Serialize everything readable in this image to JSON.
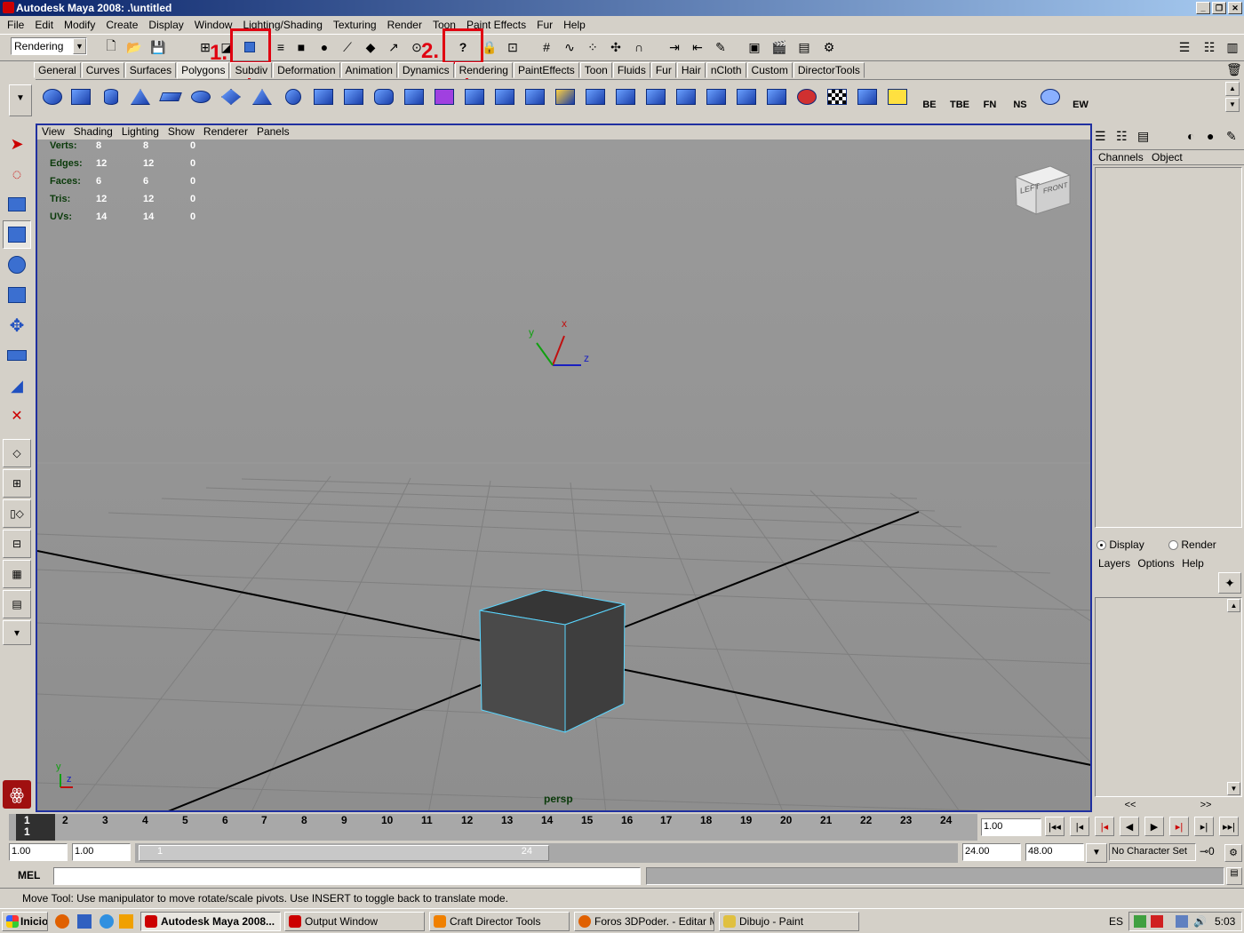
{
  "window": {
    "title": "Autodesk Maya 2008: .\\untitled",
    "min": "_",
    "max": "❐",
    "close": "✕"
  },
  "menu": [
    "File",
    "Edit",
    "Modify",
    "Create",
    "Display",
    "Window",
    "Lighting/Shading",
    "Texturing",
    "Render",
    "Toon",
    "Paint Effects",
    "Fur",
    "Help"
  ],
  "toolbar": {
    "menu_set": "Rendering"
  },
  "shelf_tabs": [
    "General",
    "Curves",
    "Surfaces",
    "Polygons",
    "Subdiv",
    "Deformation",
    "Animation",
    "Dynamics",
    "Rendering",
    "PaintEffects",
    "Toon",
    "Fluids",
    "Fur",
    "Hair",
    "nCloth",
    "Custom",
    "DirectorTools"
  ],
  "shelf_labels": [
    "BE",
    "TBE",
    "FN",
    "NS",
    "EW"
  ],
  "annotations": {
    "one": "1.",
    "two": "2.",
    "help_icon": "?"
  },
  "viewport": {
    "menu": [
      "View",
      "Shading",
      "Lighting",
      "Show",
      "Renderer",
      "Panels"
    ],
    "hud": [
      {
        "label": "Verts:",
        "a": "8",
        "b": "8",
        "c": "0"
      },
      {
        "label": "Edges:",
        "a": "12",
        "b": "12",
        "c": "0"
      },
      {
        "label": "Faces:",
        "a": "6",
        "b": "6",
        "c": "0"
      },
      {
        "label": "Tris:",
        "a": "12",
        "b": "12",
        "c": "0"
      },
      {
        "label": "UVs:",
        "a": "14",
        "b": "14",
        "c": "0"
      }
    ],
    "camera": "persp",
    "viewcube": {
      "left": "LEFT",
      "front": "FRONT"
    },
    "axis": {
      "x": "x",
      "y": "y",
      "z": "z"
    }
  },
  "channel_box": {
    "channels": "Channels",
    "object": "Object"
  },
  "layer_editor": {
    "display": "Display",
    "render": "Render",
    "menu": [
      "Layers",
      "Options",
      "Help"
    ],
    "prev": "<<",
    "next": ">>"
  },
  "timeline": {
    "frames": [
      "1",
      "2",
      "3",
      "4",
      "5",
      "6",
      "7",
      "8",
      "9",
      "10",
      "11",
      "12",
      "13",
      "14",
      "15",
      "16",
      "17",
      "18",
      "19",
      "20",
      "21",
      "22",
      "23",
      "24"
    ],
    "current": "1",
    "current_field": "1.00"
  },
  "range": {
    "start": "1.00",
    "playback_start": "1.00",
    "slider_start": "1",
    "slider_end": "24",
    "playback_end": "24.00",
    "end": "48.00",
    "character_set": "No Character Set"
  },
  "command_line": {
    "label": "MEL",
    "value": ""
  },
  "help_line": "Move Tool: Use manipulator to move rotate/scale pivots. Use INSERT to toggle back to translate mode.",
  "taskbar": {
    "start": "Inicio",
    "tasks": [
      "Autodesk Maya 2008...",
      "Output Window",
      "Craft Director Tools",
      "Foros 3DPoder. - Editar M...",
      "Dibujo - Paint"
    ],
    "lang": "ES",
    "time": "5:03"
  }
}
